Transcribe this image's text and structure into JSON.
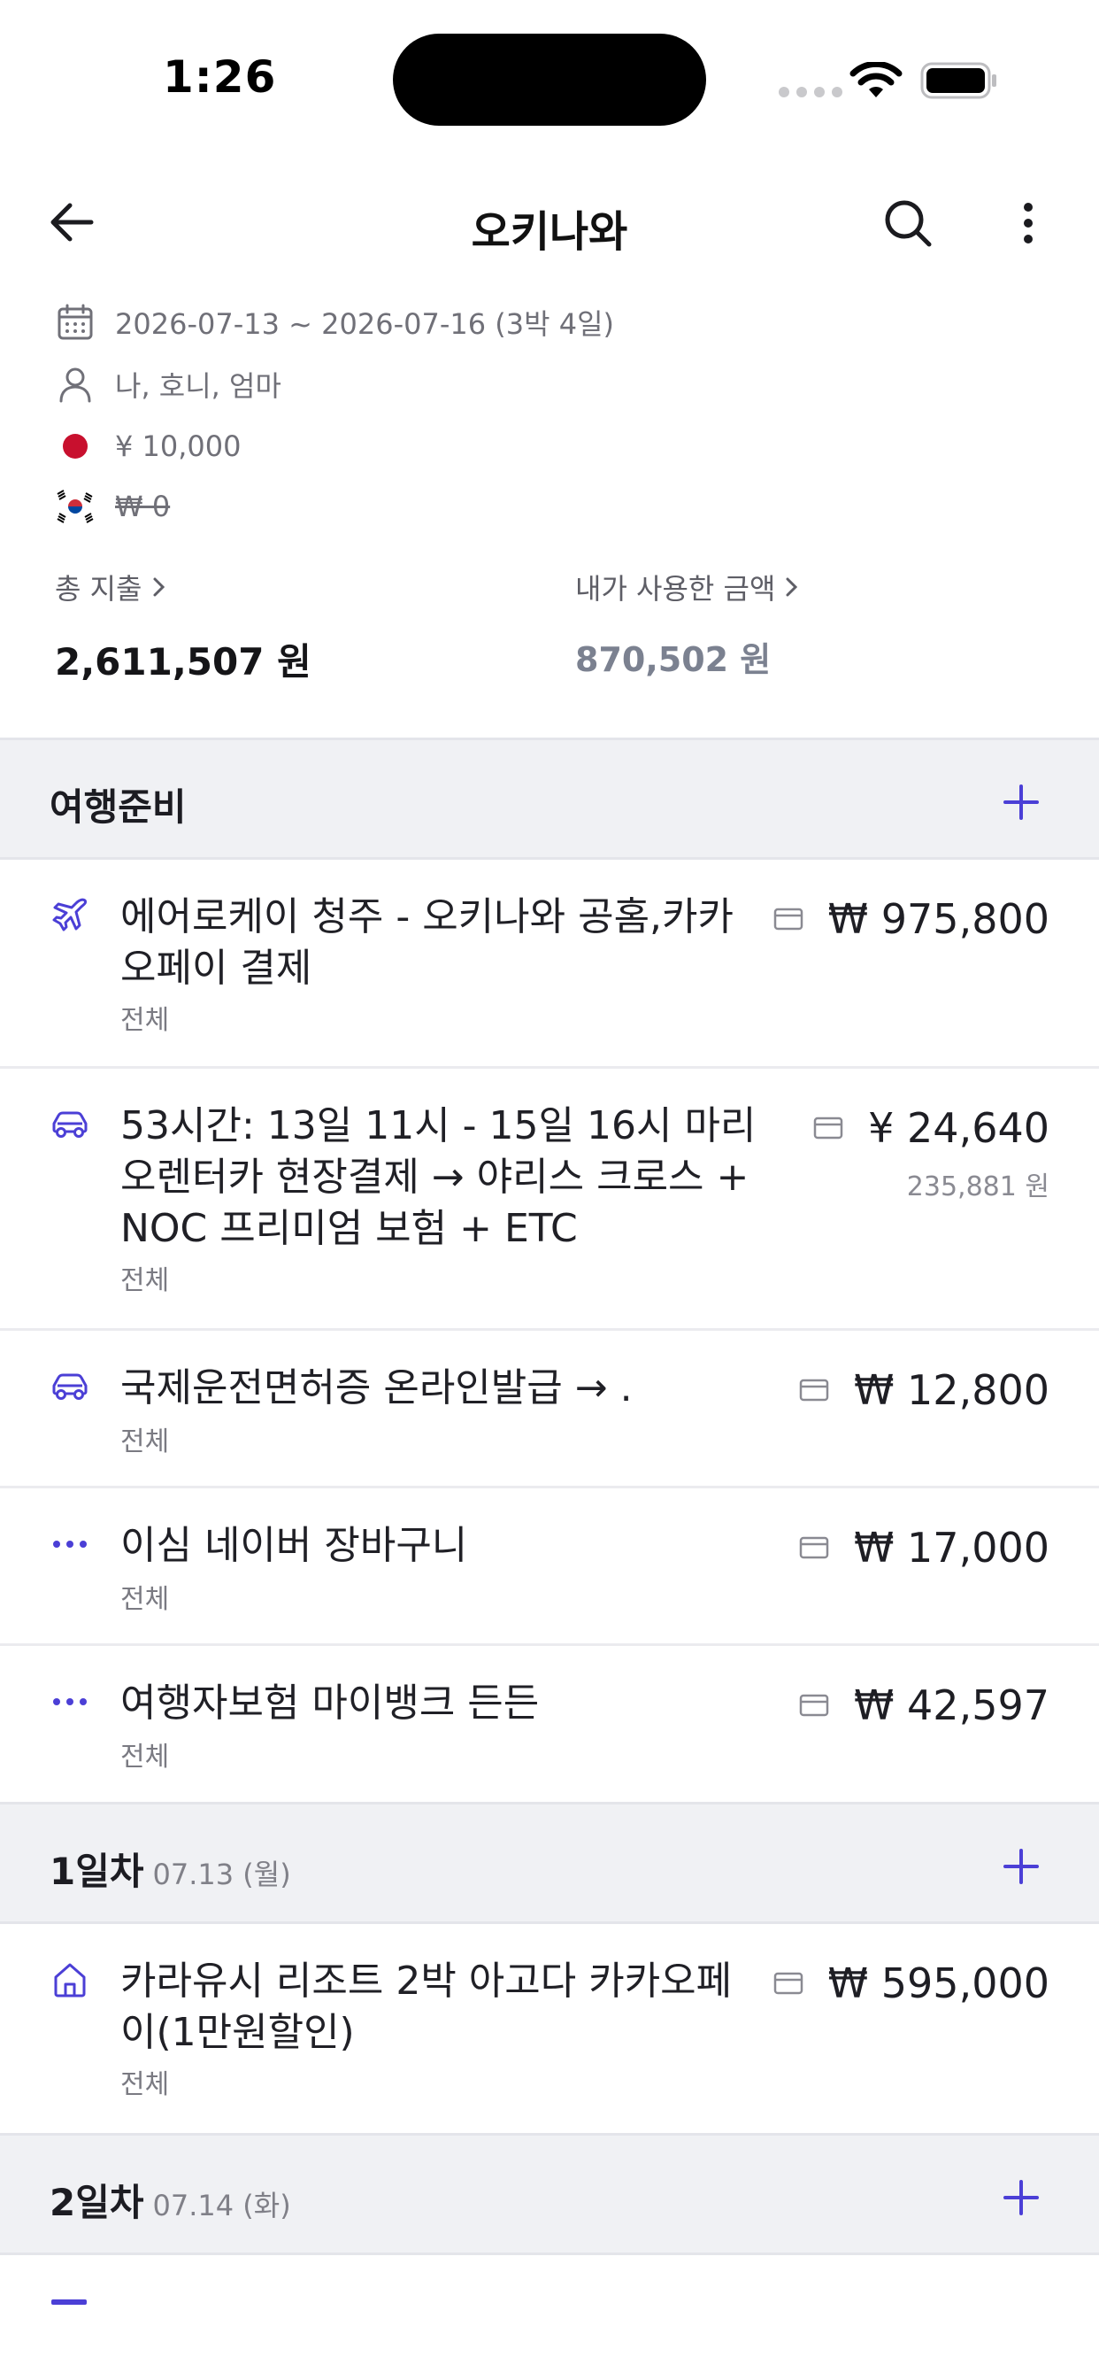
{
  "status_bar": {
    "time": "1:26"
  },
  "header": {
    "title": "오키나와"
  },
  "trip": {
    "dates": "2026-07-13 ~ 2026-07-16 (3박 4일)",
    "members": "나, 호니, 엄마",
    "jpy_budget": "¥ 10,000",
    "krw_budget": "₩ 0"
  },
  "summary": {
    "total_label": "총 지출",
    "total_value": "2,611,507 원",
    "mine_label": "내가 사용한 금액",
    "mine_value": "870,502 원"
  },
  "sections": [
    {
      "title": "여행준비",
      "date": "",
      "items": [
        {
          "icon": "plane-icon",
          "title_lines": [
            "에어로케이 청주 - 오키나와 공홈,카카",
            "오페이 결제"
          ],
          "sub": "전체",
          "amount": "₩ 975,800",
          "krw": ""
        },
        {
          "icon": "car-icon",
          "title_lines": [
            "53시간: 13일 11시 - 15일 16시 마리",
            "오렌터카 현장결제 → 야리스 크로스 +",
            "NOC 프리미엄 보험 + ETC"
          ],
          "sub": "전체",
          "amount": "¥ 24,640",
          "krw": "235,881 원"
        },
        {
          "icon": "car-icon",
          "title_lines": [
            "국제운전면허증 온라인발급 → ."
          ],
          "sub": "전체",
          "amount": "₩ 12,800",
          "krw": ""
        },
        {
          "icon": "more-dots-icon",
          "title_lines": [
            "이심 네이버 장바구니"
          ],
          "sub": "전체",
          "amount": "₩ 17,000",
          "krw": ""
        },
        {
          "icon": "more-dots-icon",
          "title_lines": [
            "여행자보험 마이뱅크 든든"
          ],
          "sub": "전체",
          "amount": "₩ 42,597",
          "krw": ""
        }
      ]
    },
    {
      "title": "1일차",
      "date": "07.13 (월)",
      "items": [
        {
          "icon": "home-icon",
          "title_lines": [
            "카라유시 리조트 2박 아고다 카카오페",
            "이(1만원할인)"
          ],
          "sub": "전체",
          "amount": "₩ 595,000",
          "krw": ""
        }
      ]
    },
    {
      "title": "2일차",
      "date": "07.14 (화)",
      "items": []
    }
  ],
  "colors": {
    "accent": "#4b3fd6",
    "section_bg": "#f0f1f4",
    "japan_flag": "#c8102e"
  }
}
